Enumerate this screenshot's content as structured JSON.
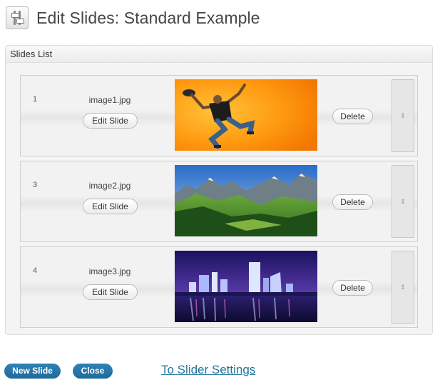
{
  "header": {
    "title": "Edit Slides: Standard Example",
    "icon": "sliders-icon"
  },
  "panel": {
    "title": "Slides List"
  },
  "slides": [
    {
      "number": "1",
      "filename": "image1.jpg",
      "edit_label": "Edit Slide",
      "delete_label": "Delete",
      "image": "jumping-man-orange-background"
    },
    {
      "number": "3",
      "filename": "image2.jpg",
      "edit_label": "Edit Slide",
      "delete_label": "Delete",
      "image": "green-mountain-valley"
    },
    {
      "number": "4",
      "filename": "image3.jpg",
      "edit_label": "Edit Slide",
      "delete_label": "Delete",
      "image": "city-skyline-at-night"
    }
  ],
  "footer": {
    "new_slide_label": "New Slide",
    "close_label": "Close",
    "settings_link_label": "To Slider Settings"
  },
  "colors": {
    "button_blue": "#2579ac",
    "link_blue": "#21759b"
  }
}
